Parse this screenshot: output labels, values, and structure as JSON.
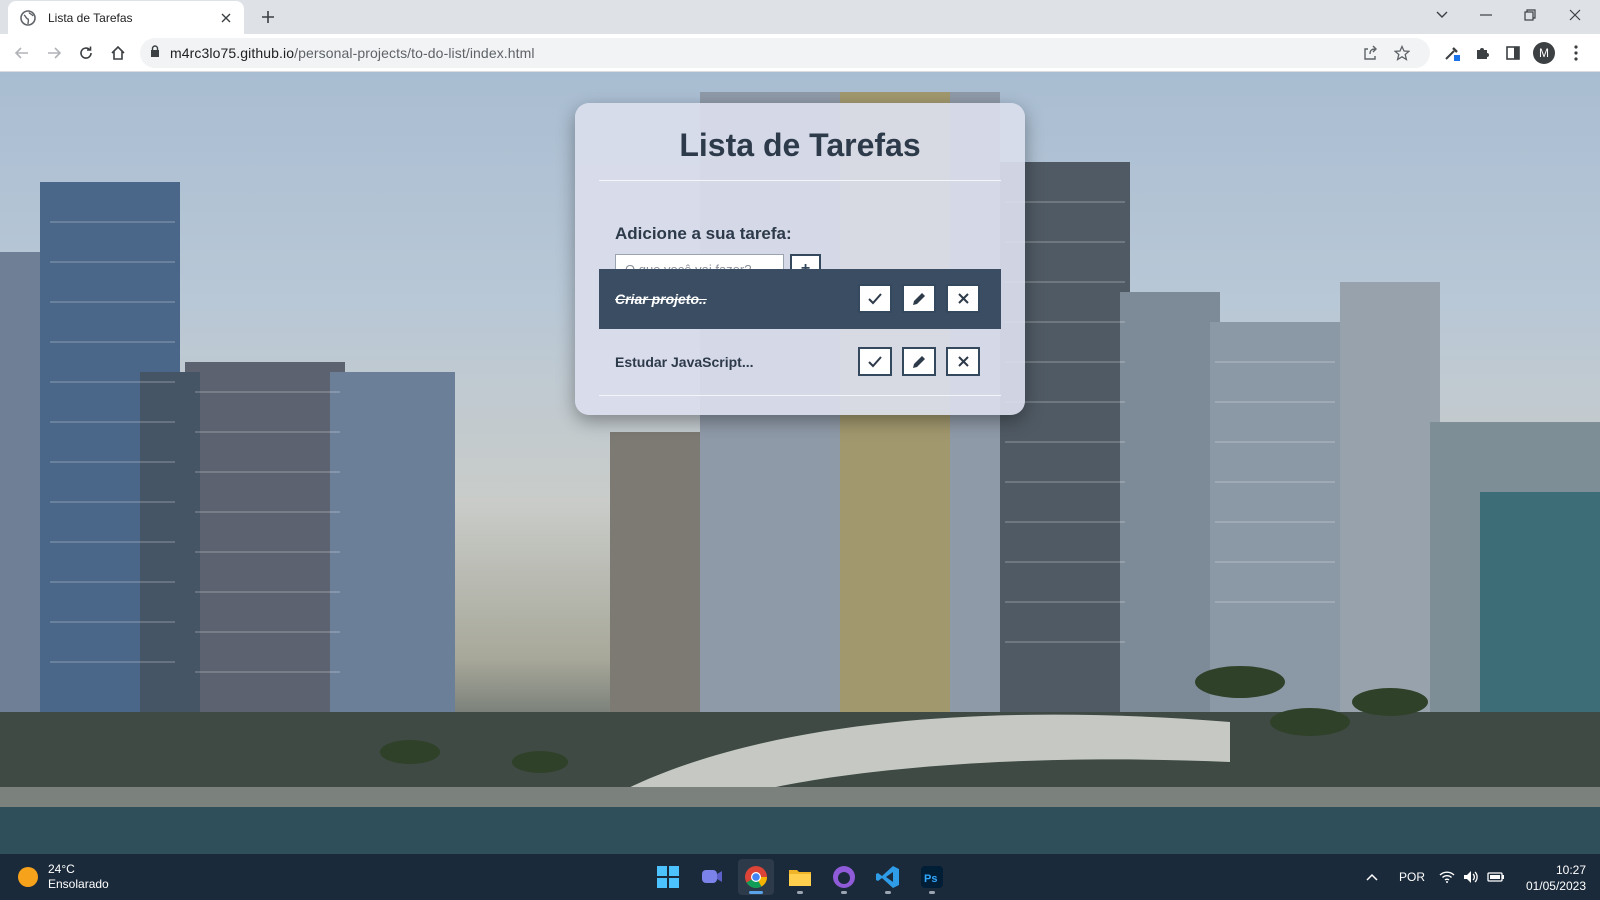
{
  "browser": {
    "tab_title": "Lista de Tarefas",
    "url_host": "m4rc3lo75.github.io",
    "url_path": "/personal-projects/to-do-list/index.html",
    "profile_initial": "M"
  },
  "app": {
    "title": "Lista de Tarefas",
    "add_label": "Adicione a sua tarefa:",
    "input_placeholder": "O que você vai fazer?",
    "input_value": "",
    "add_button_label": "+",
    "todos": [
      {
        "text": "Criar projeto..",
        "done": true
      },
      {
        "text": "Estudar JavaScript...",
        "done": false
      }
    ]
  },
  "taskbar": {
    "weather_temp": "24°C",
    "weather_desc": "Ensolarado",
    "language": "POR",
    "time": "10:27",
    "date": "01/05/2023",
    "apps": [
      "start-icon",
      "chat-icon",
      "chrome-icon",
      "file-explorer-icon",
      "github-desktop-icon",
      "vscode-icon",
      "photoshop-icon"
    ]
  },
  "colors": {
    "accent": "#34495e",
    "done_row": "#3a4d63",
    "card": "#dadeec",
    "title_text": "#2d3a4a"
  }
}
